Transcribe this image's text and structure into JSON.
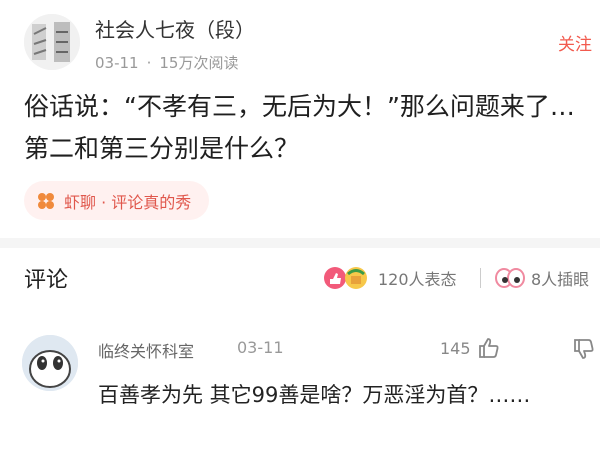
{
  "post": {
    "author_name": "社会人七夜（段）",
    "date": "03-11",
    "separator": "·",
    "views": "15万次阅读",
    "follow_label": "关注",
    "title": "俗话说：“不孝有三，无后为大！”那么问题来了…第二和第三分别是什么？",
    "source_tag": "虾聊 · 评论真的秀"
  },
  "comments_bar": {
    "title": "评论",
    "reactions": "120人表态",
    "inserts": "8人插眼"
  },
  "comment": {
    "user": "临终关怀科室",
    "date": "03-11",
    "likes": "145",
    "text": "百善孝为先 其它99善是啥？万恶淫为首？……"
  },
  "colors": {
    "accent": "#f25a4e",
    "tag_bg": "#fff1f0",
    "divider": "#f5f5f5"
  }
}
